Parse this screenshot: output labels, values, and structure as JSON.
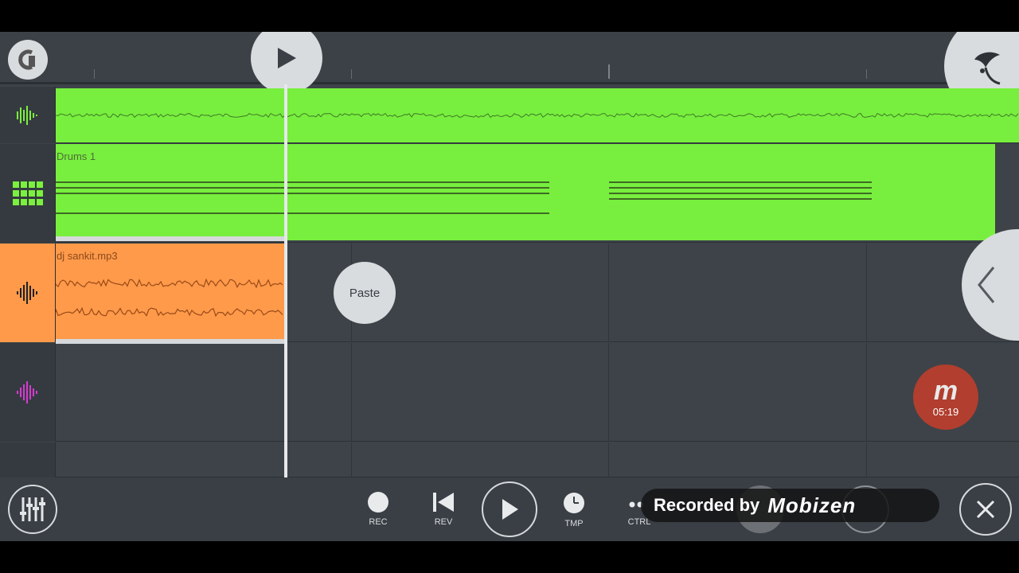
{
  "tracks": [
    {
      "kind": "audio",
      "icon": "waveform-icon",
      "icon_color": "#7bf03e"
    },
    {
      "kind": "pattern",
      "icon": "drum-pads-icon",
      "icon_color": "#7bf03e",
      "clip_label": "Drums 1"
    },
    {
      "kind": "audio",
      "icon": "waveform-icon",
      "icon_color": "#1f2226",
      "clip_label": "dj sankit.mp3"
    },
    {
      "kind": "audio",
      "icon": "waveform-icon",
      "icon_color": "#d63bd0"
    }
  ],
  "context_menu": {
    "paste_label": "Paste"
  },
  "transport": {
    "rec_label": "REC",
    "rev_label": "REV",
    "tmp_label": "TMP",
    "ctrl_label": "CTRL"
  },
  "recorder_badge": {
    "time": "05:19",
    "letter": "m"
  },
  "overlay": {
    "recorded_by": "Recorded by",
    "brand": "Mobizen"
  },
  "colors": {
    "green_clip": "#78ef3e",
    "orange_clip": "#ff9a4a",
    "magenta_track": "#d63bd0",
    "background": "#3d4349"
  }
}
